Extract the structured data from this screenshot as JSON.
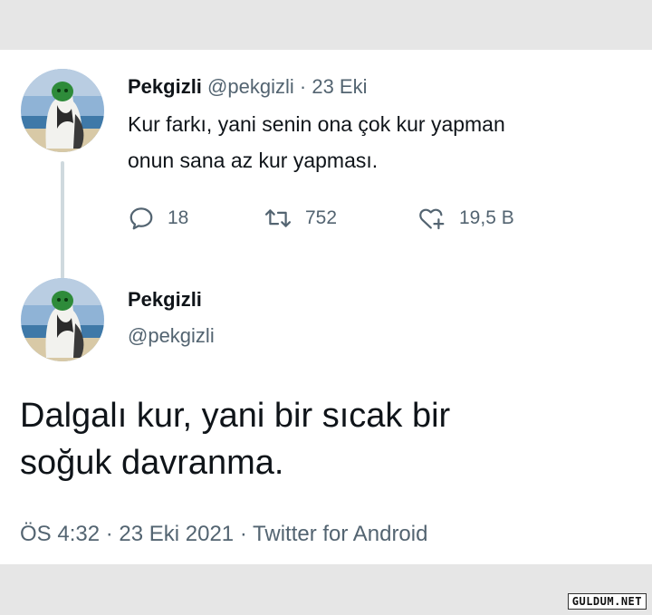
{
  "quoted_tweet": {
    "author_name": "Pekgizli",
    "handle": "@pekgizli",
    "separator": "·",
    "date": "23 Eki",
    "text_line1": "Kur farkı, yani senin ona çok kur yapman",
    "text_line2": "onun sana az kur yapması.",
    "replies": "18",
    "retweets": "752",
    "likes": "19,5 B",
    "avatar": "cat-statue-avatar"
  },
  "main_tweet": {
    "author_name": "Pekgizli",
    "handle": "@pekgizli",
    "text_line1": "Dalgalı kur, yani bir sıcak bir",
    "text_line2": "soğuk davranma.",
    "timestamp": "ÖS 4:32 · 23 Eki 2021 · Twitter for Android",
    "avatar": "cat-statue-avatar"
  },
  "watermark": "GULDUM.NET",
  "colors": {
    "background": "#e6e6e6",
    "card": "#ffffff",
    "text": "#0f1419",
    "muted": "#536471",
    "thread_line": "#cfd9de"
  }
}
